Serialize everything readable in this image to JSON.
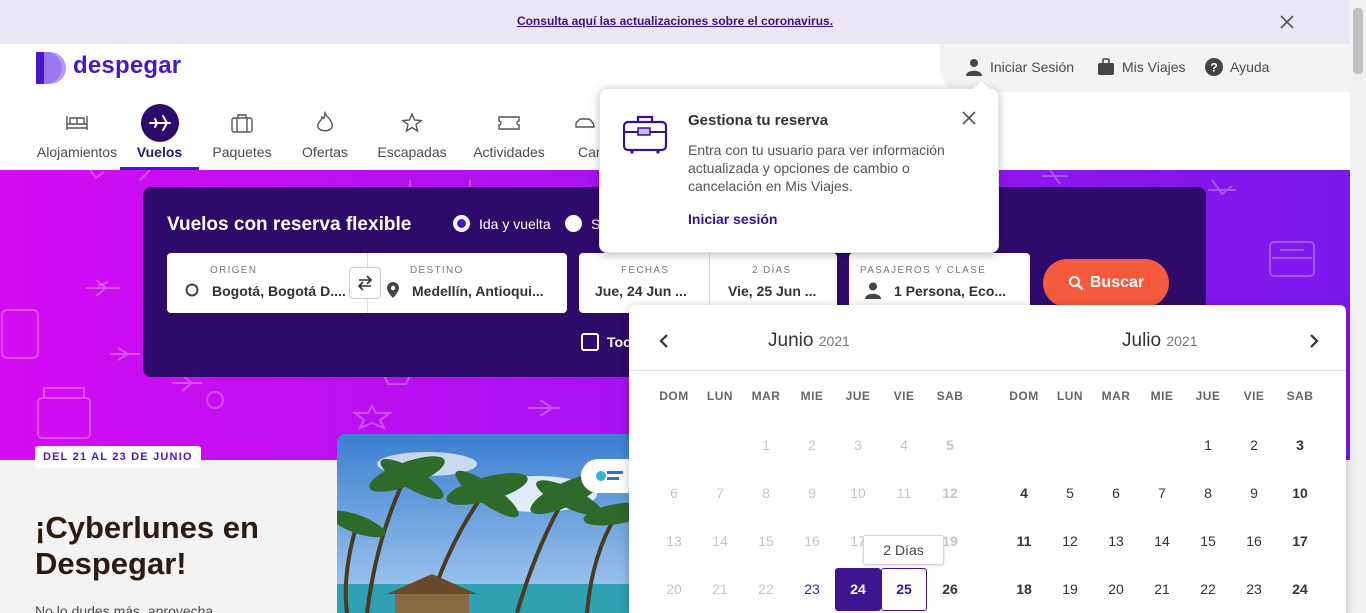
{
  "banner": {
    "link_text": "Consulta aquí las actualizaciones sobre el coronavirus."
  },
  "brand": {
    "name": "despegar",
    "color": "#4a17c7"
  },
  "user_menu": {
    "login": "Iniciar Sesión",
    "trips": "Mis Viajes",
    "help": "Ayuda"
  },
  "nav": {
    "items": [
      {
        "label": "Alojamientos",
        "icon": "bed-icon"
      },
      {
        "label": "Vuelos",
        "icon": "plane-icon",
        "active": true
      },
      {
        "label": "Paquetes",
        "icon": "suitcase-icon"
      },
      {
        "label": "Ofertas",
        "icon": "fire-icon"
      },
      {
        "label": "Escapadas",
        "icon": "star-plane-icon"
      },
      {
        "label": "Actividades",
        "icon": "ticket-icon"
      },
      {
        "label": "Car",
        "icon": "car-icon"
      }
    ]
  },
  "search": {
    "title": "Vuelos con reserva flexible",
    "trip_types": [
      {
        "label": "Ida y vuelta",
        "selected": true
      },
      {
        "label": "S",
        "selected": false
      }
    ],
    "origin": {
      "label": "ORIGEN",
      "value": "Bogotá, Bogotá D...."
    },
    "destination": {
      "label": "DESTINO",
      "value": "Medellín, Antioqui..."
    },
    "dates": {
      "label": "FECHAS",
      "depart": "Jue, 24 Jun ...",
      "days_label": "2 DÍAS",
      "return": "Vie, 25 Jun ..."
    },
    "passengers": {
      "label": "PASAJEROS Y CLASE",
      "value": "1 Persona, Eco..."
    },
    "submit": "Buscar",
    "checkbox_label": "Too"
  },
  "promo": {
    "badge": "DEL 21 AL 23 DE JUNIO",
    "title": "¡Cyberlunes en Despegar!",
    "subtitle": "No lo dudes más, aprovecha"
  },
  "popover": {
    "title": "Gestiona tu reserva",
    "body": "Entra con tu usuario para ver información actualizada y opciones de cambio o cancelación en Mis Viajes.",
    "link": "Iniciar sesión"
  },
  "calendar": {
    "months": [
      {
        "name": "Junio",
        "year": "2021"
      },
      {
        "name": "Julio",
        "year": "2021"
      }
    ],
    "weekdays": [
      "DOM",
      "LUN",
      "MAR",
      "MIE",
      "JUE",
      "VIE",
      "SAB"
    ],
    "june_rows": [
      [
        "",
        "",
        "1",
        "2",
        "3",
        "4",
        "5"
      ],
      [
        "6",
        "7",
        "8",
        "9",
        "10",
        "11",
        "12"
      ],
      [
        "13",
        "14",
        "15",
        "16",
        "17",
        "18",
        "19"
      ],
      [
        "20",
        "21",
        "22",
        "23",
        "24",
        "25",
        "26"
      ]
    ],
    "july_rows": [
      [
        "",
        "",
        "",
        "",
        "1",
        "2",
        "3"
      ],
      [
        "4",
        "5",
        "6",
        "7",
        "8",
        "9",
        "10"
      ],
      [
        "11",
        "12",
        "13",
        "14",
        "15",
        "16",
        "17"
      ],
      [
        "18",
        "19",
        "20",
        "21",
        "22",
        "23",
        "24"
      ]
    ],
    "selected_start": "24",
    "selected_end": "25",
    "range_tooltip": "2 Días"
  }
}
